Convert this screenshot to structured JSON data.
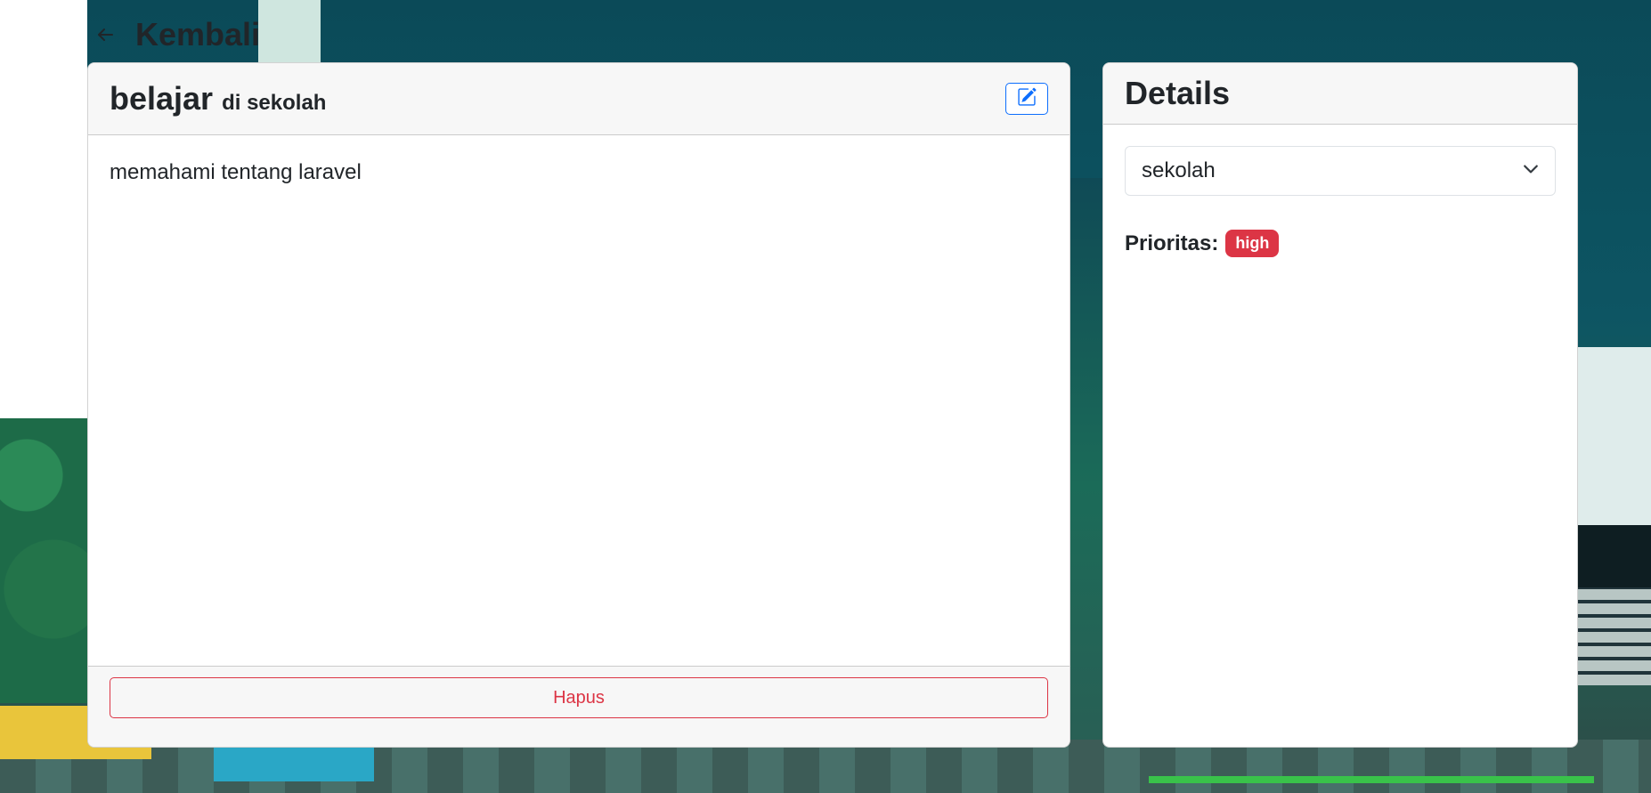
{
  "header": {
    "back_label": "Kembali",
    "back_icon": "arrow-left-icon"
  },
  "task": {
    "title": "belajar",
    "location": "di sekolah",
    "description": "memahami tentang laravel",
    "edit_icon": "pencil-square-icon",
    "delete_label": "Hapus"
  },
  "details": {
    "title": "Details",
    "category_selected": "sekolah",
    "priority_label": "Prioritas:",
    "priority_value": "high"
  },
  "colors": {
    "primary": "#0d6efd",
    "danger": "#dc3545",
    "card_header_bg": "#f7f7f7"
  }
}
